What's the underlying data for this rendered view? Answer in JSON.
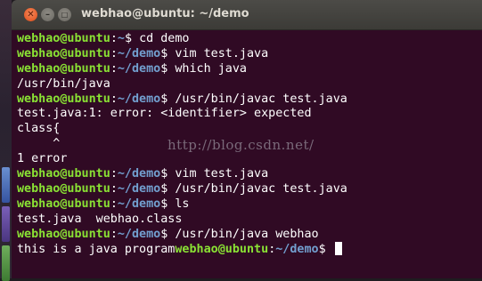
{
  "window": {
    "title": "webhao@ubuntu: ~/demo",
    "close_glyph": "✕",
    "min_glyph": "–",
    "max_glyph": "□"
  },
  "colors": {
    "user": "#8ae234",
    "path": "#729fcf",
    "background": "#300a24",
    "text": "#ffffff"
  },
  "prompt": {
    "user": "webhao@ubuntu",
    "colon": ":",
    "dollar": "$ "
  },
  "lines": [
    {
      "type": "prompt",
      "path": "~",
      "cmd": "cd demo"
    },
    {
      "type": "prompt",
      "path": "~/demo",
      "cmd": "vim test.java"
    },
    {
      "type": "prompt",
      "path": "~/demo",
      "cmd": "which java"
    },
    {
      "type": "out",
      "text": "/usr/bin/java"
    },
    {
      "type": "prompt",
      "path": "~/demo",
      "cmd": "/usr/bin/javac test.java"
    },
    {
      "type": "out",
      "text": "test.java:1: error: <identifier> expected"
    },
    {
      "type": "out",
      "text": "class{"
    },
    {
      "type": "out",
      "text": "     ^"
    },
    {
      "type": "out",
      "text": "1 error"
    },
    {
      "type": "prompt",
      "path": "~/demo",
      "cmd": "vim test.java"
    },
    {
      "type": "prompt",
      "path": "~/demo",
      "cmd": "/usr/bin/javac test.java"
    },
    {
      "type": "prompt",
      "path": "~/demo",
      "cmd": "ls"
    },
    {
      "type": "out",
      "text": "test.java  webhao.class"
    },
    {
      "type": "prompt",
      "path": "~/demo",
      "cmd": "/usr/bin/java webhao"
    },
    {
      "type": "mixed",
      "prefix": "this is a java program",
      "path": "~/demo",
      "cmd": ""
    }
  ],
  "watermark": "http://blog.csdn.net/"
}
